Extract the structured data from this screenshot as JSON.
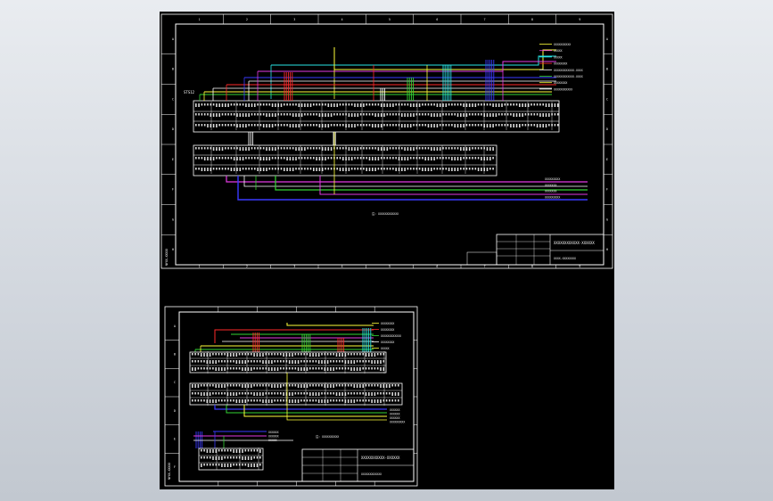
{
  "colors": {
    "background": "#000000",
    "frame": "#ffffff",
    "red": "#ff2a2a",
    "green": "#34d434",
    "yellow": "#ffff3a",
    "cyan": "#28e6e6",
    "magenta": "#e23ae2",
    "blue": "#3a3aff",
    "white": "#ffffff"
  },
  "sheet1": {
    "col_numbers": [
      "1",
      "2",
      "3",
      "4",
      "5",
      "6",
      "7",
      "8",
      "9"
    ],
    "row_letters": [
      "A",
      "B",
      "C",
      "D",
      "E",
      "F",
      "G",
      "H"
    ],
    "left_tag": "STS12",
    "left_vertical_label": "NYXX-XXXXX",
    "note": "注: XXXXXXXXXXXX",
    "right_labels_top": [
      "XXXXXXXXXX",
      "XXXXX",
      "XXXXX",
      "XXXXXXXX",
      "XXXXXXXXXXXX-XXXX",
      "XXXXXXXXXXXX-XXXX",
      "XXXXXXXX",
      "XXXXXXXXXXX"
    ],
    "right_labels_bottom": [
      "XXXXXXXXX",
      "XXXXXXX",
      "XXXXXXX",
      "XXXXXXXXX"
    ],
    "title_block": {
      "title": "XXXXXXXXXXXX-XXXXXX",
      "subtitle": "XXXX-XXXXXXXX"
    }
  },
  "sheet2": {
    "row_letters": [
      "A",
      "B",
      "C",
      "D",
      "E",
      "F"
    ],
    "left_vertical_label": "NYXX-XXXXX",
    "note": "注: XXXXXXXXXX",
    "right_labels": [
      "XXXXXXXX",
      "XXXXXXXX",
      "XXXXXXXXXXXX",
      "XXXXXXXX",
      "XXXXX"
    ],
    "bottom_labels": [
      "XXXXXX",
      "XXXXXX",
      "XXXXXX",
      "XXXXXXXXX"
    ],
    "lower_right_labels": [
      "XXXXXX",
      "XXXXXX",
      "XXXXX"
    ],
    "title_block": {
      "title": "XXXXXXXXXXX-XXXXXX",
      "subtitle": "XXXXXXXXXXXX"
    }
  }
}
